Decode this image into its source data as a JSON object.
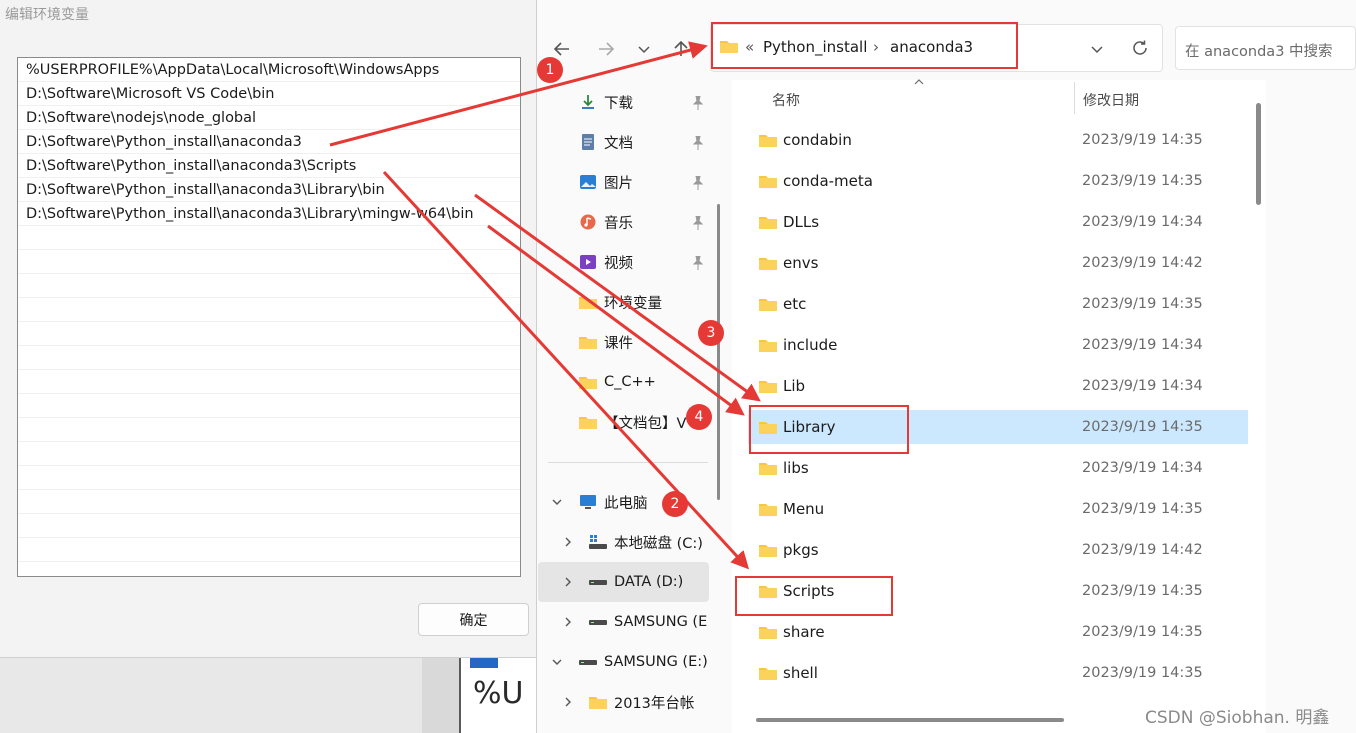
{
  "env_dialog": {
    "title": "编辑环境变量",
    "entries": [
      "%USERPROFILE%\\AppData\\Local\\Microsoft\\WindowsApps",
      "D:\\Software\\Microsoft VS Code\\bin",
      "D:\\Software\\nodejs\\node_global",
      "D:\\Software\\Python_install\\anaconda3",
      "D:\\Software\\Python_install\\anaconda3\\Scripts",
      "D:\\Software\\Python_install\\anaconda3\\Library\\bin",
      "D:\\Software\\Python_install\\anaconda3\\Library\\mingw-w64\\bin"
    ],
    "ok_label": "确定"
  },
  "background_peek_text": "%U",
  "explorer": {
    "breadcrumb": {
      "overflow": "«",
      "parent": "Python_install",
      "separator": "›",
      "current": "anaconda3"
    },
    "search_placeholder": "在 anaconda3 中搜索",
    "nav": {
      "quick_access": [
        {
          "label": "下载",
          "icon": "download-icon",
          "pinned": true
        },
        {
          "label": "文档",
          "icon": "document-icon",
          "pinned": true
        },
        {
          "label": "图片",
          "icon": "picture-icon",
          "pinned": true
        },
        {
          "label": "音乐",
          "icon": "music-icon",
          "pinned": true
        },
        {
          "label": "视频",
          "icon": "video-icon",
          "pinned": true
        },
        {
          "label": "环境变量",
          "icon": "folder-icon",
          "pinned": false
        },
        {
          "label": "课件",
          "icon": "folder-icon",
          "pinned": false
        },
        {
          "label": "C_C++",
          "icon": "folder-icon",
          "pinned": false
        },
        {
          "label": "【文档包】V",
          "icon": "folder-icon",
          "pinned": false
        }
      ],
      "this_pc": "此电脑",
      "drives": [
        {
          "label": "本地磁盘 (C:)",
          "icon": "windows-drive-icon"
        },
        {
          "label": "DATA (D:)",
          "icon": "drive-icon",
          "selected": true
        },
        {
          "label": "SAMSUNG (E",
          "icon": "drive-icon"
        }
      ],
      "samsung_root": "SAMSUNG (E:)",
      "samsung_child": "2013年台帐"
    },
    "columns": {
      "name": "名称",
      "modified": "修改日期"
    },
    "files": [
      {
        "name": "condabin",
        "date": "2023/9/19 14:35"
      },
      {
        "name": "conda-meta",
        "date": "2023/9/19 14:35"
      },
      {
        "name": "DLLs",
        "date": "2023/9/19 14:34"
      },
      {
        "name": "envs",
        "date": "2023/9/19 14:42"
      },
      {
        "name": "etc",
        "date": "2023/9/19 14:35"
      },
      {
        "name": "include",
        "date": "2023/9/19 14:34"
      },
      {
        "name": "Lib",
        "date": "2023/9/19 14:34"
      },
      {
        "name": "Library",
        "date": "2023/9/19 14:35",
        "selected": true
      },
      {
        "name": "libs",
        "date": "2023/9/19 14:34"
      },
      {
        "name": "Menu",
        "date": "2023/9/19 14:35"
      },
      {
        "name": "pkgs",
        "date": "2023/9/19 14:42"
      },
      {
        "name": "Scripts",
        "date": "2023/9/19 14:35"
      },
      {
        "name": "share",
        "date": "2023/9/19 14:35"
      },
      {
        "name": "shell",
        "date": "2023/9/19 14:35"
      }
    ]
  },
  "annotations": {
    "color": "#e53935",
    "badges": [
      "1",
      "2",
      "3",
      "4"
    ]
  },
  "watermark": "CSDN @Siobhan. 明鑫",
  "colors": {
    "selection": "#cce8ff",
    "folder": "#f8c640",
    "annotation_red": "#e53935"
  }
}
